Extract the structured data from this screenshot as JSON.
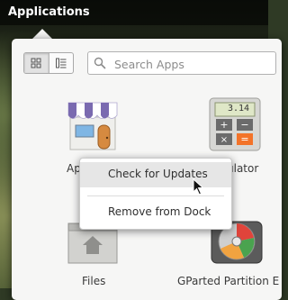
{
  "topbar": {
    "title": "Applications"
  },
  "toolbar": {
    "grid_view_icon": "grid-icon",
    "category_view_icon": "category-list-icon",
    "search_placeholder": "Search Apps"
  },
  "apps": [
    {
      "name": "AppCenter",
      "label": "Ap",
      "icon": "appcenter-store-icon"
    },
    {
      "name": "Calculator",
      "label": "ulator",
      "icon": "calculator-icon",
      "display_value": "3.14"
    },
    {
      "name": "Files",
      "label": "Files",
      "icon": "folder-home-icon"
    },
    {
      "name": "GParted Partition Editor",
      "label": "GParted Partition E",
      "icon": "gparted-disk-icon"
    }
  ],
  "context_menu": {
    "items": [
      {
        "label": "Check for Updates"
      },
      {
        "label": "Remove from Dock"
      }
    ]
  },
  "colors": {
    "popover_bg": "#f6f6f5",
    "awning_purple": "#7a6ab0",
    "calc_orange": "#f37329"
  }
}
